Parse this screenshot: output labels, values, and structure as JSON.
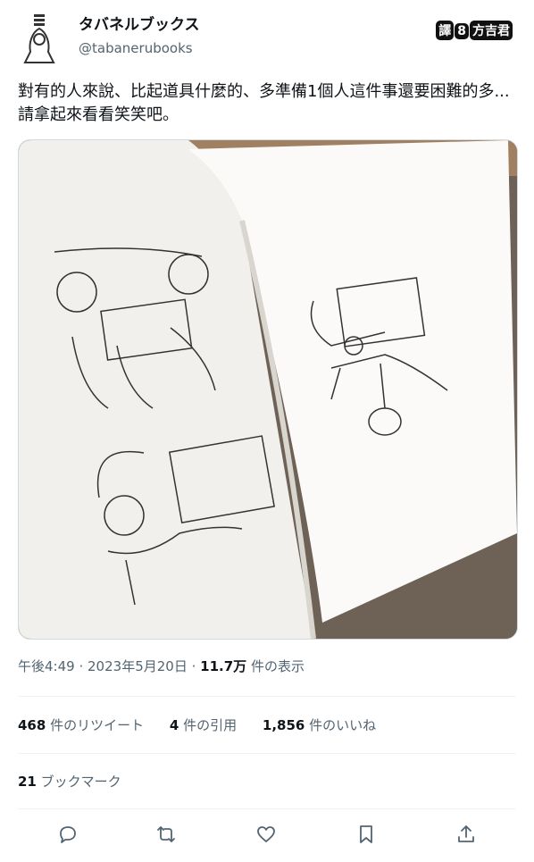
{
  "header": {
    "display_name": "タバネルブックス",
    "handle": "@tabanerubooks",
    "badge_parts": [
      "譯",
      "8",
      "方吉君"
    ]
  },
  "tweet": {
    "text": "對有的人來說、比起道具什麼的、多準備1個人這件事還要困難的多...請拿起來看看笑笑吧。"
  },
  "meta": {
    "time": "午後4:49",
    "date": "2023年5月20日",
    "views": "11.7万",
    "views_label": "件の表示"
  },
  "stats": {
    "retweets_count": "468",
    "retweets_label": "件のリツイート",
    "quotes_count": "4",
    "quotes_label": "件の引用",
    "likes_count": "1,856",
    "likes_label": "件のいいね",
    "bookmarks_count": "21",
    "bookmarks_label": "ブックマーク"
  },
  "actions": [
    "reply-icon",
    "retweet-icon",
    "like-icon",
    "bookmark-icon",
    "share-icon"
  ]
}
